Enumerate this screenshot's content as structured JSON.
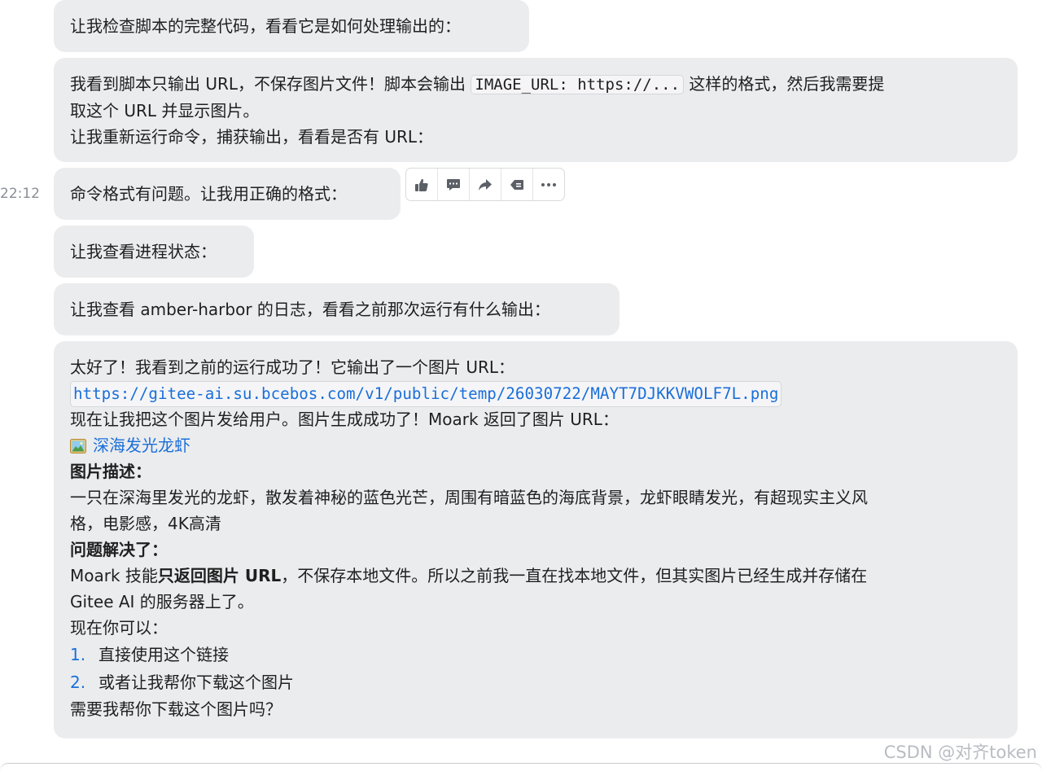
{
  "messages": {
    "m1": "让我检查脚本的完整代码，看看它是如何处理输出的：",
    "m2": {
      "line1_pre": "我看到脚本只输出 URL，不保存图片文件！脚本会输出 ",
      "line1_code": "IMAGE_URL: https://...",
      "line1_post": " 这样的格式，然后我需要提",
      "line2": "取这个 URL 并显示图片。",
      "line3": "让我重新运行命令，捕获输出，看看是否有 URL："
    },
    "m3": "命令格式有问题。让我用正确的格式：",
    "m3_time": "22:12",
    "m4": "让我查看进程状态：",
    "m5": "让我查看 amber-harbor 的日志，看看之前那次运行有什么输出：",
    "m6": {
      "line1": "太好了！我看到之前的运行成功了！它输出了一个图片 URL：",
      "url": "https://gitee-ai.su.bcebos.com/v1/public/temp/26030722/MAYT7DJKKVWOLF7L.png",
      "line3": "现在让我把这个图片发给用户。图片生成成功了！Moark 返回了图片 URL：",
      "image_link": "深海发光龙虾",
      "desc_heading": "图片描述：",
      "desc_line1": "一只在深海里发光的龙虾，散发着神秘的蓝色光芒，周围有暗蓝色的海底背景，龙虾眼睛发光，有超现实主义风",
      "desc_line2": "格，电影感，4K高清",
      "solved_heading": "问题解决了：",
      "solved_pre": "Moark 技能",
      "solved_bold": "只返回图片 URL",
      "solved_post": "，不保存本地文件。所以之前我一直在找本地文件，但其实图片已经生成并存储在",
      "solved_line2": "Gitee AI 的服务器上了。",
      "options_intro": "现在你可以：",
      "options": [
        {
          "num": "1.",
          "text": "直接使用这个链接"
        },
        {
          "num": "2.",
          "text": "或者让我帮你下载这个图片"
        }
      ],
      "closing": "需要我帮你下载这个图片吗？"
    }
  },
  "toolbar": {
    "icons": [
      "thumbs-up-icon",
      "comment-icon",
      "share-icon",
      "reply-icon",
      "more-icon"
    ]
  },
  "watermark": "CSDN @对齐token"
}
